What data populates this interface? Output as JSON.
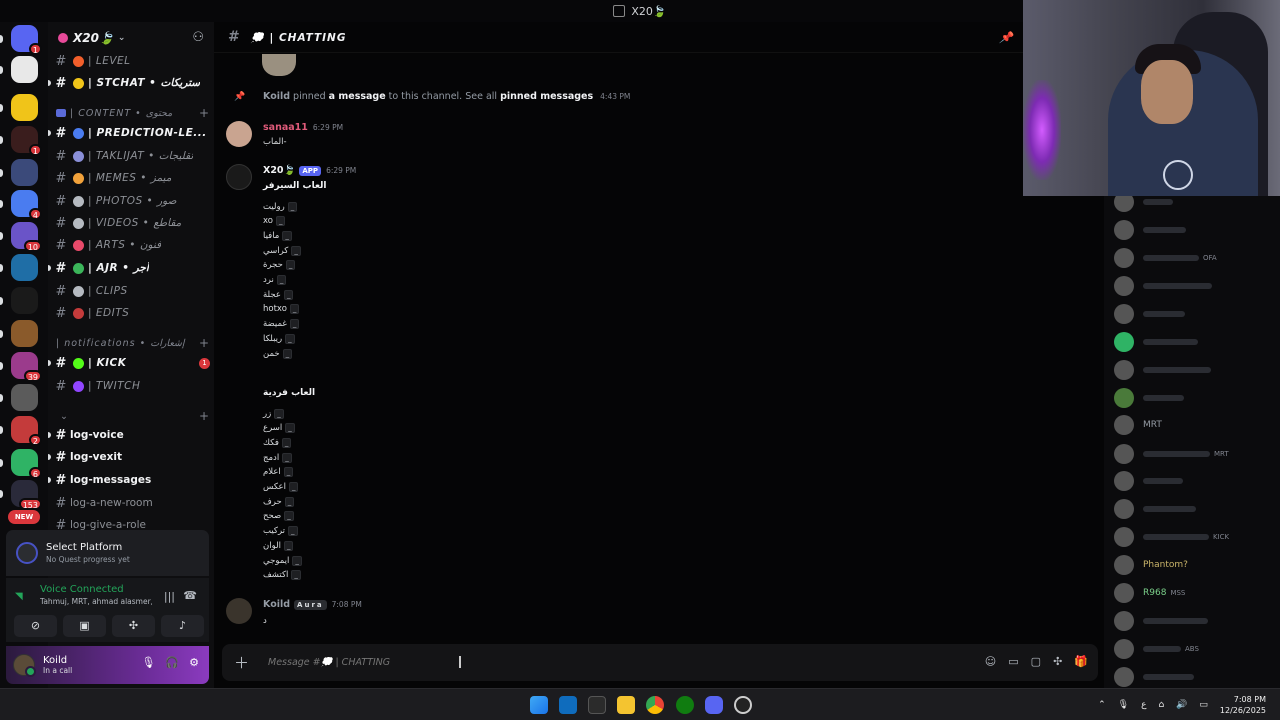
{
  "window": {
    "title": "X20🍃"
  },
  "rail": {
    "servers": [
      {
        "name": "discord-home",
        "color": "#5865f2",
        "badge": "1"
      },
      {
        "name": "server-2",
        "color": "#e8e8e8",
        "badge": ""
      },
      {
        "name": "server-3",
        "color": "#f0c419",
        "badge": ""
      },
      {
        "name": "server-4",
        "color": "#3a1d1d",
        "badge": "1"
      },
      {
        "name": "server-5",
        "color": "#3b4a7a",
        "badge": ""
      },
      {
        "name": "server-6",
        "color": "#4a7cf0",
        "badge": "4"
      },
      {
        "name": "server-7",
        "color": "#6a54c8",
        "badge": "10"
      },
      {
        "name": "server-8",
        "color": "#1f6ea6",
        "badge": ""
      },
      {
        "name": "server-9",
        "color": "#1a1a1a",
        "badge": ""
      },
      {
        "name": "server-10",
        "color": "#8a5a2b",
        "badge": ""
      },
      {
        "name": "server-11",
        "color": "#9b3b8c",
        "badge": "39"
      },
      {
        "name": "server-12",
        "color": "#5b5b5b",
        "badge": ""
      },
      {
        "name": "server-13",
        "color": "#c43b3b",
        "badge": "2"
      },
      {
        "name": "server-14",
        "color": "#2fb365",
        "badge": "6"
      },
      {
        "name": "server-15",
        "color": "#2a2a3a",
        "badge": "153"
      }
    ],
    "new_label": "NEW"
  },
  "sidebar": {
    "server_name": "X20🍃",
    "channels_top": [
      {
        "name": "| LEVEL",
        "emoji_color": "#f25f2b",
        "bright": false
      },
      {
        "name": "| STCHAT • ستريكات",
        "emoji_color": "#f0c419",
        "bright": true
      }
    ],
    "category_content": "| CONTENT • محتوى",
    "channels_content": [
      {
        "name": "| PREDICTION-LE...",
        "emoji_color": "#4a7cf0",
        "bright": true
      },
      {
        "name": "| TAKLIJAT • تقليجات",
        "emoji_color": "#8a8fd8",
        "bright": false
      },
      {
        "name": "| MEMES • ميمز",
        "emoji_color": "#f2a23b",
        "bright": false
      },
      {
        "name": "| PHOTOS • صور",
        "emoji_color": "#b5bac1",
        "bright": false
      },
      {
        "name": "| VIDEOS • مقاطع",
        "emoji_color": "#b5bac1",
        "bright": false
      },
      {
        "name": "| ARTS • فنون",
        "emoji_color": "#e84a6a",
        "bright": false
      },
      {
        "name": "| AJR • أجر",
        "emoji_color": "#3bb55a",
        "bright": true
      },
      {
        "name": "| CLIPS",
        "emoji_color": "#b5bac1",
        "bright": false
      },
      {
        "name": "| EDITS",
        "emoji_color": "#c43b3b",
        "bright": false
      }
    ],
    "category_notifications": "| notifications • إشعارات",
    "channels_notif": [
      {
        "name": "| KICK",
        "emoji_color": "#53fc18",
        "bright": true,
        "unread": "1"
      },
      {
        "name": "| TWITCH",
        "emoji_color": "#9146ff",
        "bright": false,
        "unread": ""
      }
    ],
    "channels_log": [
      {
        "name": "log-voice",
        "bright": true
      },
      {
        "name": "log-vexit",
        "bright": true
      },
      {
        "name": "log-messages",
        "bright": true
      },
      {
        "name": "log-a-new-room",
        "bright": false
      },
      {
        "name": "log-give-a-role",
        "bright": false
      }
    ]
  },
  "quest": {
    "title": "Select Platform",
    "subtitle": "No Quest progress yet"
  },
  "voice": {
    "status": "Voice Connected",
    "channel": "Tahmuj, MRT, ahmad alasmer,..."
  },
  "user": {
    "name": "Koild",
    "status": "In a call"
  },
  "chat": {
    "channel_name": "💭 | CHATTING",
    "system": {
      "user": "Koild",
      "text1": "pinned",
      "link1": "a message",
      "text2": "to this channel. See all",
      "link2": "pinned messages",
      "time": "4:43 PM"
    },
    "msg1": {
      "author": "sanaa11",
      "time": "6:29 PM",
      "text": "الماب-",
      "color": "#e05b7a"
    },
    "msg2": {
      "author": "X20🍃",
      "tag": "APP",
      "time": "6:29 PM",
      "heading1": "العاب السيرفر",
      "list1": [
        "روليت",
        "xo",
        "مافيا",
        "كراسي",
        "حجرة",
        "نرد",
        "عجلة",
        "hotxo",
        "غميضة",
        "ريبلكا",
        "خمن"
      ],
      "heading2": "العاب فردية",
      "list2": [
        "زر",
        "اسرع",
        "فكك",
        "ادمج",
        "اعلام",
        "اعكس",
        "حرف",
        "صحح",
        "تركيب",
        "الوان",
        "ايموجي",
        "اكتشف"
      ],
      "code": "_"
    },
    "msg3": {
      "author": "Koild",
      "tag": "Aura",
      "time": "7:08 PM",
      "text": "د"
    },
    "composer_placeholder": "Message #💭 | CHATTING"
  },
  "members": [
    {
      "name": "",
      "color": "#555"
    },
    {
      "name": "",
      "color": "#555"
    },
    {
      "name": "",
      "tag": "OFA",
      "color": "#555"
    },
    {
      "name": "",
      "color": "#555"
    },
    {
      "name": "",
      "color": "#555"
    },
    {
      "name": "",
      "color": "#2fb365"
    },
    {
      "name": "",
      "color": "#555"
    },
    {
      "name": "",
      "color": "#4a7a3a"
    },
    {
      "name": "MRT",
      "color": "#555"
    },
    {
      "name": "",
      "tag": "MRT",
      "color": "#555"
    },
    {
      "name": "",
      "color": "#555"
    },
    {
      "name": "",
      "color": "#555"
    },
    {
      "name": "",
      "tag": "KICK",
      "color": "#555"
    },
    {
      "name": "Phantom?",
      "color": "#555"
    },
    {
      "name": "R968",
      "tag": "MSS",
      "color": "#555"
    },
    {
      "name": "",
      "color": "#555"
    },
    {
      "name": "",
      "tag": "ABS",
      "color": "#555"
    },
    {
      "name": "",
      "color": "#555"
    }
  ],
  "taskbar": {
    "time": "7:08 PM",
    "date": "12/26/2025",
    "lang": "ع"
  }
}
